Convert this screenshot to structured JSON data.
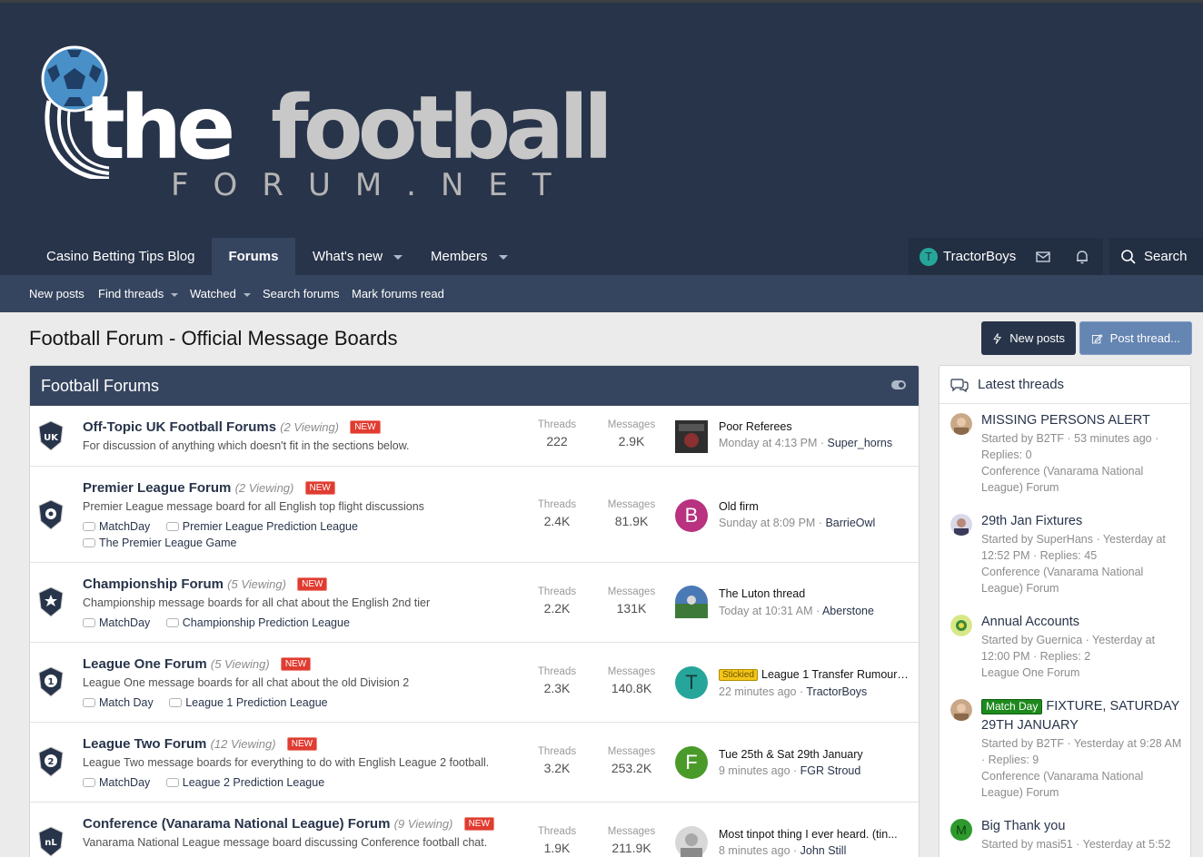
{
  "logo": {
    "word1": "the",
    "word2": "football",
    "sub": "FORUM.NET"
  },
  "nav": {
    "items": [
      {
        "label": "Casino Betting Tips Blog"
      },
      {
        "label": "Forums"
      },
      {
        "label": "What's new"
      },
      {
        "label": "Members"
      }
    ],
    "user": "TractorBoys",
    "user_initial": "T",
    "search": "Search"
  },
  "subnav": {
    "items": [
      {
        "label": "New posts"
      },
      {
        "label": "Find threads"
      },
      {
        "label": "Watched"
      },
      {
        "label": "Search forums"
      },
      {
        "label": "Mark forums read"
      }
    ]
  },
  "page": {
    "title": "Football Forum - Official Message Boards",
    "new_posts_label": "New posts",
    "post_thread_label": "Post thread..."
  },
  "forum_block": {
    "title": "Football Forums",
    "threads_label": "Threads",
    "messages_label": "Messages",
    "new_label": "NEW",
    "forums": [
      {
        "title": "Off-Topic UK Football Forums",
        "viewing": "(2 Viewing)",
        "desc": "For discussion of anything which doesn't fit in the sections below.",
        "threads": "222",
        "messages": "2.9K",
        "last_title": "Poor Referees",
        "last_date": "Monday at 4:13 PM",
        "last_user": "Super_horns",
        "badge": "UK"
      },
      {
        "title": "Premier League Forum",
        "viewing": "(2 Viewing)",
        "desc": "Premier League message board for all English top flight discussions",
        "subforums": [
          "MatchDay",
          "Premier League Prediction League",
          "The Premier League Game"
        ],
        "threads": "2.4K",
        "messages": "81.9K",
        "last_title": "Old firm",
        "last_date": "Sunday at 8:09 PM",
        "last_user": "BarrieOwl",
        "last_initial": "B"
      },
      {
        "title": "Championship Forum",
        "viewing": "(5 Viewing)",
        "desc": "Championship message boards for all chat about the English 2nd tier",
        "subforums": [
          "MatchDay",
          "Championship Prediction League"
        ],
        "threads": "2.2K",
        "messages": "131K",
        "last_title": "The Luton thread",
        "last_date": "Today at 10:31 AM",
        "last_user": "Aberstone"
      },
      {
        "title": "League One Forum",
        "viewing": "(5 Viewing)",
        "desc": "League One message boards for all chat about the old Division 2",
        "subforums": [
          "Match Day",
          "League 1 Prediction League"
        ],
        "threads": "2.3K",
        "messages": "140.8K",
        "last_prefix": "Stickied",
        "last_title": "League 1 Transfer Rumours...",
        "last_date": "22 minutes ago",
        "last_user": "TractorBoys",
        "last_initial": "T",
        "badge": "1"
      },
      {
        "title": "League Two Forum",
        "viewing": "(12 Viewing)",
        "desc": "League Two message boards for everything to do with English League 2 football.",
        "subforums": [
          "MatchDay",
          "League 2 Prediction League"
        ],
        "threads": "3.2K",
        "messages": "253.2K",
        "last_title": "Tue 25th & Sat 29th January",
        "last_date": "9 minutes ago",
        "last_user": "FGR Stroud",
        "last_initial": "F",
        "badge": "2"
      },
      {
        "title": "Conference (Vanarama National League) Forum",
        "viewing": "(9 Viewing)",
        "desc": "Vanarama National League message board discussing Conference football chat.",
        "threads": "1.9K",
        "messages": "211.9K",
        "last_title": "Most tinpot thing I ever heard. (tin...",
        "last_date": "8 minutes ago",
        "last_user": "John Still",
        "badge": "nL"
      }
    ]
  },
  "sidebar": {
    "title": "Latest threads",
    "threads": [
      {
        "title": "MISSING PERSONS ALERT",
        "meta": "Started by B2TF · 53 minutes ago · Replies: 0",
        "forum": "Conference (Vanarama National League) Forum"
      },
      {
        "title": "29th Jan Fixtures",
        "meta": "Started by SuperHans · Yesterday at 12:52 PM · Replies: 45",
        "forum": "Conference (Vanarama National League) Forum"
      },
      {
        "title": "Annual Accounts",
        "meta": "Started by Guernica · Yesterday at 12:00 PM · Replies: 2",
        "forum": "League One Forum"
      },
      {
        "prefix": "Match Day",
        "title": "FIXTURE, SATURDAY 29TH JANUARY",
        "meta": "Started by B2TF · Yesterday at 9:28 AM · Replies: 9",
        "forum": "Conference (Vanarama National League) Forum"
      },
      {
        "title": "Big Thank you",
        "meta": "Started by masi51 · Yesterday at 5:52",
        "initial": "M"
      }
    ]
  },
  "colors": {
    "header_bg": "#28344a",
    "subnav_bg": "#36455f",
    "new_badge": "#e03c31",
    "stickied": "#f5c518",
    "match_day": "#1e8a1e"
  },
  "icons": [
    "football-logo-icon",
    "envelope-icon",
    "bell-icon",
    "search-icon",
    "bolt-icon",
    "compose-icon",
    "toggle-icon",
    "chat-bubbles-icon",
    "shield-icon",
    "speech-bubble-icon"
  ]
}
